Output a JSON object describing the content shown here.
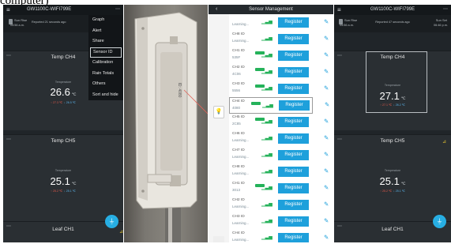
{
  "caption": "computer)",
  "panel1": {
    "menu_icon": "hamburger-icon",
    "title": "GW1100C-WIFI799E",
    "more_icon": "ellipsis-icon",
    "sun_rise_label": "Sun Rise",
    "sun_rise_time": "05:56 a.m.",
    "reported": "Reported 21 seconds ago",
    "menu": [
      "Graph",
      "Alert",
      "Share",
      "Sensor ID",
      "Calibration",
      "Rain Totals",
      "Others",
      "Sort and hide"
    ],
    "menu_selected": "Sensor ID",
    "cards": [
      {
        "title": "Temp CH4",
        "label": "Temperature",
        "value": "26.6",
        "unit": "℃",
        "hi": "27.3 ℃",
        "lo": "26.5 ℃"
      },
      {
        "title": "Temp CH5",
        "label": "Temperature",
        "value": "25.1",
        "unit": "℃",
        "hi": "25.2 ℃",
        "lo": "25.1 ℃"
      },
      {
        "title": "Leaf CH1"
      }
    ],
    "fab_icon": "filter-icon"
  },
  "photo": {
    "label": "ID: 4080"
  },
  "panel3": {
    "back_icon": "back-arrow-icon",
    "title": "Sensor Management",
    "register_label": "Register",
    "rows": [
      {
        "id": "",
        "status": "Learning..."
      },
      {
        "id": "CH8 ID",
        "status": "Learning..."
      },
      {
        "id": "CH1 ID",
        "status": "535F"
      },
      {
        "id": "CH2 ID",
        "status": "4C06"
      },
      {
        "id": "CH3 ID",
        "status": "5556"
      },
      {
        "id": "CH4 ID",
        "status": "4080",
        "highlight": true
      },
      {
        "id": "CH5 ID",
        "status": "2C85"
      },
      {
        "id": "CH6 ID",
        "status": "Learning..."
      },
      {
        "id": "CH7 ID",
        "status": "Learning..."
      },
      {
        "id": "CH8 ID",
        "status": "Learning..."
      },
      {
        "id": "CH1 ID",
        "status": "3013"
      },
      {
        "id": "CH2 ID",
        "status": "Learning..."
      },
      {
        "id": "CH3 ID",
        "status": "Learning..."
      },
      {
        "id": "CH4 ID",
        "status": "Learning..."
      }
    ]
  },
  "panel4": {
    "menu_icon": "hamburger-icon",
    "title": "GW1100C-WIFI799E",
    "more_icon": "ellipsis-icon",
    "sun_rise_label": "Sun Rise",
    "sun_rise_time": "05:56 a.m.",
    "reported": "Reported 47 seconds ago",
    "sun_set_label": "Sun Set",
    "sun_set_time": "06:46 p.m.",
    "cards": [
      {
        "title": "Temp CH4",
        "label": "Temperature",
        "value": "27.1",
        "unit": "℃",
        "hi": "27.1 ℃",
        "lo": "26.2 ℃"
      },
      {
        "title": "Temp CH5",
        "label": "Temperature",
        "value": "25.1",
        "unit": "℃",
        "hi": "25.2 ℃",
        "lo": "25.1 ℃"
      },
      {
        "title": "Leaf CH1"
      }
    ],
    "fab_icon": "filter-icon"
  }
}
